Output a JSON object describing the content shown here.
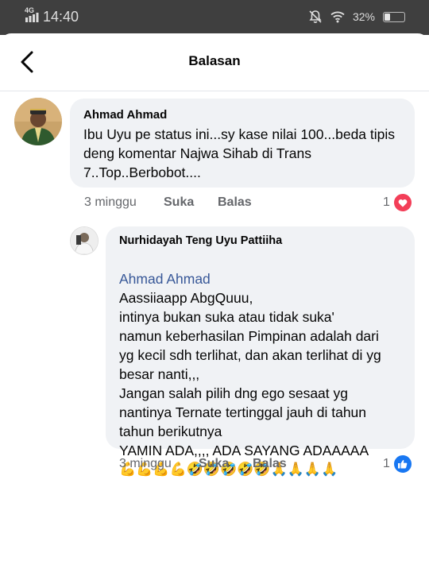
{
  "status_bar": {
    "time": "14:40",
    "network": "4G",
    "battery": "32%"
  },
  "header": {
    "title": "Balasan",
    "back_icon": "chevron-left-icon"
  },
  "comments": [
    {
      "author": "Ahmad Ahmad",
      "text": "Ibu Uyu pe status ini...sy kase nilai 100...beda tipis deng komentar Najwa Sihab di Trans 7..Top..Berbobot....",
      "time": "3 minggu",
      "like_label": "Suka",
      "reply_label": "Balas",
      "reaction_count": "1",
      "reaction_icon": "heart-icon",
      "reaction_color": "#f33e58"
    },
    {
      "author": "Nurhidayah Teng Uyu Pattiiha",
      "mention": "Ahmad Ahmad",
      "text_after_mention": "Aassiiaapp AbgQuuu,",
      "text": "intinya bukan suka atau tidak suka'\nnamun keberhasilan Pimpinan adalah dari\nyg kecil sdh terlihat, dan akan terlihat di yg\nbesar nanti,,,\nJangan salah pilih dng ego sesaat yg\nnantinya Ternate tertinggal jauh di tahun\ntahun berikutnya\nYAMIN ADA,,,, ADA SAYANG ADAAAAA",
      "emojis": "💪💪💪💪🤣🤣🤣🤣🤣🙏🙏🙏🙏",
      "time": "3 minggu",
      "like_label": "Suka",
      "reply_label": "Balas",
      "reaction_count": "1",
      "reaction_icon": "thumbs-up-icon",
      "reaction_color": "#1877f2"
    }
  ]
}
